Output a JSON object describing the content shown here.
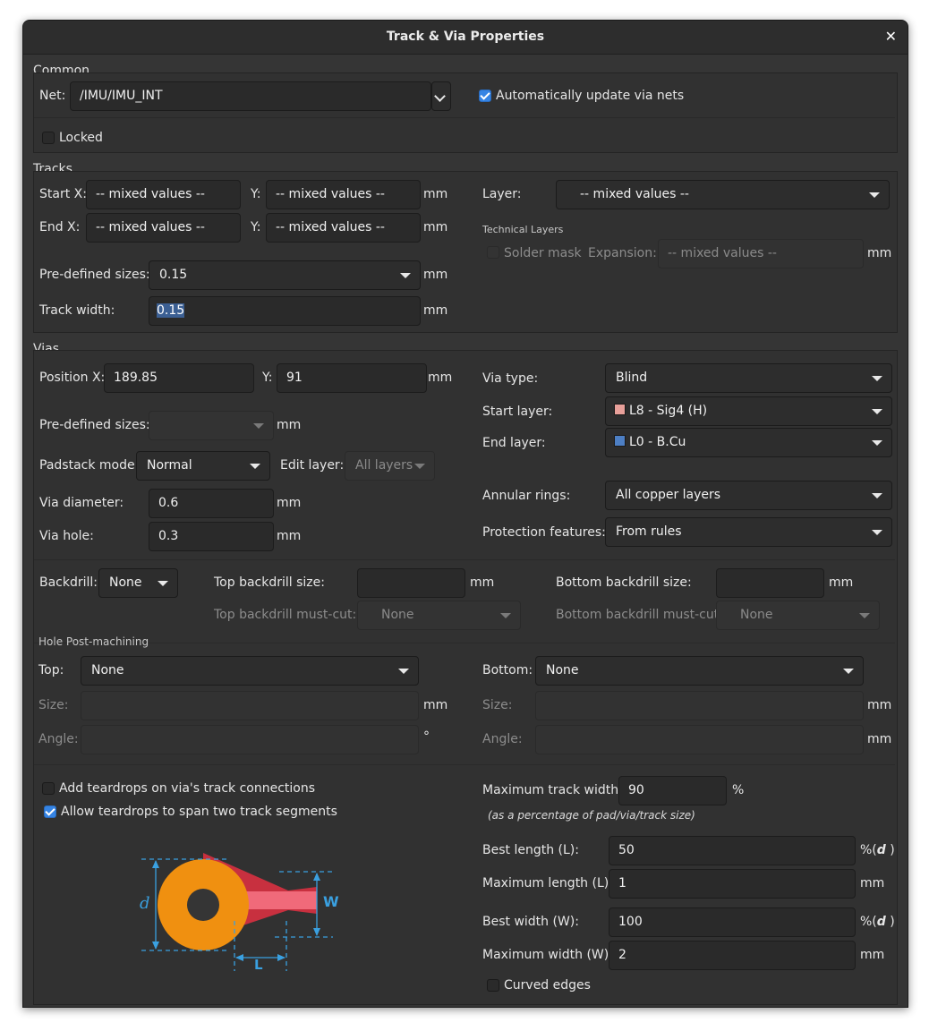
{
  "window": {
    "title": "Track & Via Properties"
  },
  "common": {
    "group": "Common",
    "net_label": "Net:",
    "net_value": "/IMU/IMU_INT",
    "auto_update_label": "Automatically update via nets",
    "auto_update_checked": true,
    "locked_label": "Locked",
    "locked_checked": false
  },
  "tracks": {
    "group": "Tracks",
    "start_x_label": "Start X:",
    "start_x": "-- mixed values --",
    "start_y_label": "Y:",
    "start_y": "-- mixed values --",
    "end_x_label": "End X:",
    "end_x": "-- mixed values --",
    "end_y_label": "Y:",
    "end_y": "-- mixed values --",
    "unit": "mm",
    "layer_label": "Layer:",
    "layer_value": "-- mixed values --",
    "technical_layers": "Technical Layers",
    "solder_mask_label": "Solder mask",
    "expansion_label": "Expansion:",
    "expansion_value": "-- mixed values --",
    "predefined_label": "Pre-defined sizes:",
    "predefined_value": "0.15",
    "track_width_label": "Track width:",
    "track_width_value": "0.15"
  },
  "vias": {
    "group": "Vias",
    "pos_x_label": "Position X:",
    "pos_x": "189.85",
    "pos_y_label": "Y:",
    "pos_y": "91",
    "unit": "mm",
    "predefined_label": "Pre-defined sizes:",
    "predefined_value": "",
    "padstack_label": "Padstack mode:",
    "padstack_value": "Normal",
    "edit_layer_label": "Edit layer:",
    "edit_layer_value": "All layers",
    "diameter_label": "Via diameter:",
    "diameter_value": "0.6",
    "hole_label": "Via hole:",
    "hole_value": "0.3",
    "via_type_label": "Via type:",
    "via_type_value": "Blind",
    "start_layer_label": "Start layer:",
    "start_layer_value": "L8 - Sig4 (H)",
    "start_layer_color": "#e8a09a",
    "end_layer_label": "End layer:",
    "end_layer_value": "L0 - B.Cu",
    "end_layer_color": "#4d7fc4",
    "annular_label": "Annular rings:",
    "annular_value": "All copper layers",
    "protection_label": "Protection features:",
    "protection_value": "From rules",
    "backdrill_label": "Backdrill:",
    "backdrill_value": "None",
    "top_bd_size_label": "Top backdrill size:",
    "top_bd_size_value": "",
    "bottom_bd_size_label": "Bottom backdrill size:",
    "bottom_bd_size_value": "",
    "top_bd_mustcut_label": "Top backdrill must-cut:",
    "top_bd_mustcut_value": "None",
    "bottom_bd_mustcut_label": "Bottom backdrill must-cut:",
    "bottom_bd_mustcut_value": "None",
    "post_machining": "Hole Post-machining",
    "top_label": "Top:",
    "top_value": "None",
    "bottom_label": "Bottom:",
    "bottom_value": "None",
    "size_label": "Size:",
    "angle_label": "Angle:",
    "degree_unit": "°"
  },
  "teardrops": {
    "add_label": "Add teardrops on via's track connections",
    "add_checked": false,
    "allow_label": "Allow teardrops to span two track segments",
    "allow_checked": true,
    "max_track_width_label": "Maximum track width:",
    "max_track_width_value": "90",
    "percent_unit": "%",
    "max_track_note": "(as a percentage of pad/via/track size)",
    "best_length_label": "Best length (L):",
    "best_length_value": "50",
    "best_length_unit_prefix": "%(",
    "best_length_unit_var": "d",
    "best_length_unit_suffix": " )",
    "max_length_label": "Maximum length (L):",
    "max_length_value": "1",
    "best_width_label": "Best width (W):",
    "best_width_value": "100",
    "best_width_unit_prefix": "%(",
    "best_width_unit_var": "d",
    "best_width_unit_suffix": " )",
    "max_width_label": "Maximum width (W):",
    "max_width_value": "2",
    "mm_unit": "mm",
    "curved_label": "Curved edges",
    "curved_checked": false,
    "diagram_d": "d",
    "diagram_w": "W",
    "diagram_l": "L"
  },
  "colors": {
    "dialog_bg": "#353535",
    "accent": "#3584e4",
    "diagram_pad": "#f09010",
    "diagram_track": "#f06a7a",
    "diagram_dim": "#3aa0e0"
  },
  "icons": [
    "close-icon",
    "chevron-down-icon",
    "checkmark-icon"
  ]
}
